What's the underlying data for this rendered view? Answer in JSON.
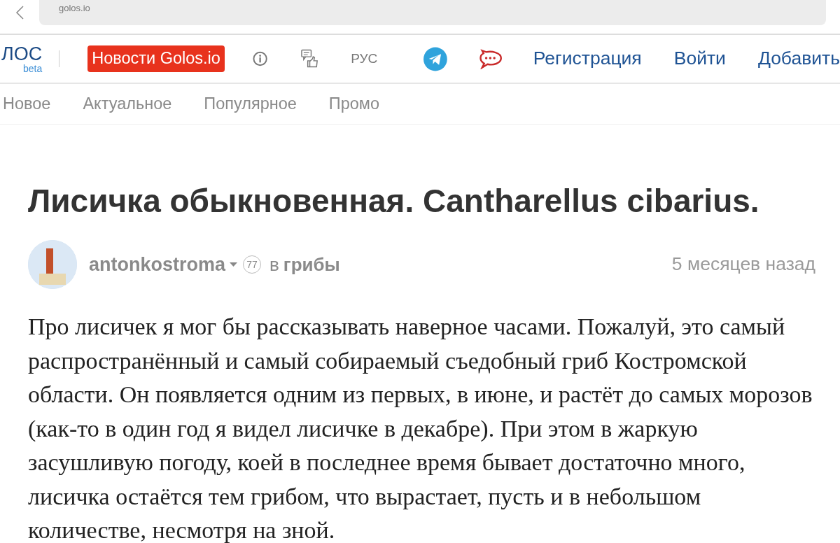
{
  "browser": {
    "domain": "golos.io"
  },
  "header": {
    "logo": "ЛОС",
    "logo_sub": "beta",
    "news_button": "Новости Golos.io",
    "language": "РУС",
    "links": [
      "Регистрация",
      "Войти",
      "Добавить"
    ]
  },
  "tabs": [
    {
      "label": "Новое",
      "selected": false
    },
    {
      "label": "Актуальное",
      "selected": false
    },
    {
      "label": "Популярное",
      "selected": false
    },
    {
      "label": "Промо",
      "selected": false
    }
  ],
  "post": {
    "title": "Лисичка обыкновенная. Cantharellus cibarius.",
    "author": "antonkostroma",
    "reputation": "77",
    "in": "в",
    "category": "грибы",
    "time": "5 месяцев назад",
    "body": "Про лисичек я мог бы рассказывать наверное часами. Пожалуй, это самый распространённый и самый собираемый съедобный гриб Костромской области. Он появляется одним из первых, в июне, и растёт до самых морозов (как-то в один год я видел лисичке в декабре). При этом в жаркую засушливую погоду, коей в последнее время бывает достаточно много, лисичка остаётся тем грибом, что вырастает, пусть и в небольшом количестве, несмотря на зной."
  }
}
